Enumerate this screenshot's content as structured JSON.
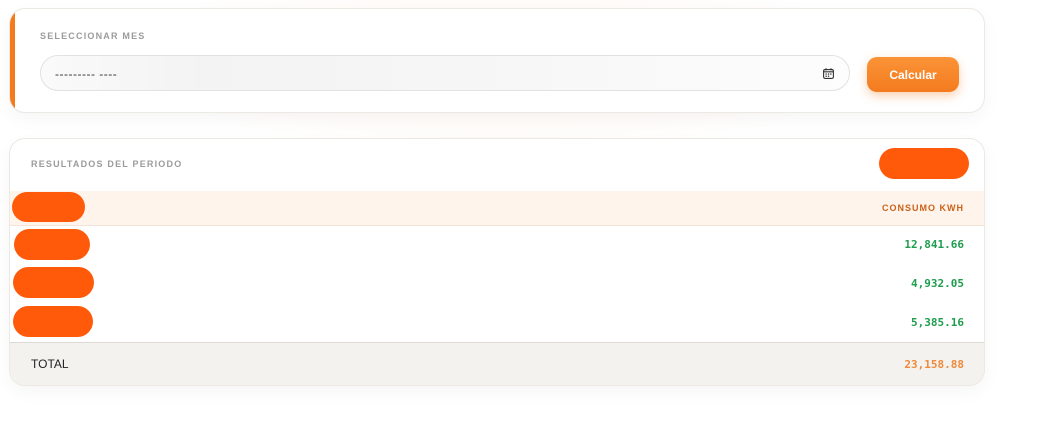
{
  "month_selector": {
    "label": "SELECCIONAR MES",
    "input_value": "--------- ----",
    "calendar_icon": "calendar-icon",
    "button_label": "Calcular"
  },
  "results": {
    "title": "RESULTADOS DEL PERIODO",
    "column_header": "CONSUMO KWH",
    "rows": [
      {
        "value": "12,841.66"
      },
      {
        "value": "4,932.05"
      },
      {
        "value": "5,385.16"
      }
    ],
    "total_label": "TOTAL",
    "total_value": "23,158.88"
  },
  "colors": {
    "accent": "#f47a1c",
    "value_green": "#1f9d4f",
    "total_orange": "#f08a3a",
    "redaction": "#ff5a0a"
  }
}
